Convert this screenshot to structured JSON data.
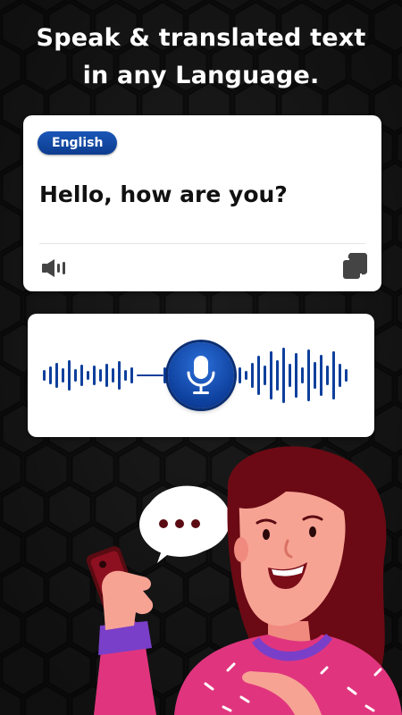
{
  "headline": {
    "line1": "Speak & translated text",
    "line2": "in any Language."
  },
  "translation_card": {
    "language": "English",
    "text": "Hello, how are you?",
    "speaker_icon": "speaker-icon",
    "copy_icon": "copy-icon"
  },
  "voice_card": {
    "mic_icon": "microphone-icon"
  },
  "colors": {
    "background": "#161616",
    "accent_blue": "#0d3f9c",
    "card": "#ffffff",
    "shirt": "#e0357e",
    "hair": "#6b0a14"
  }
}
